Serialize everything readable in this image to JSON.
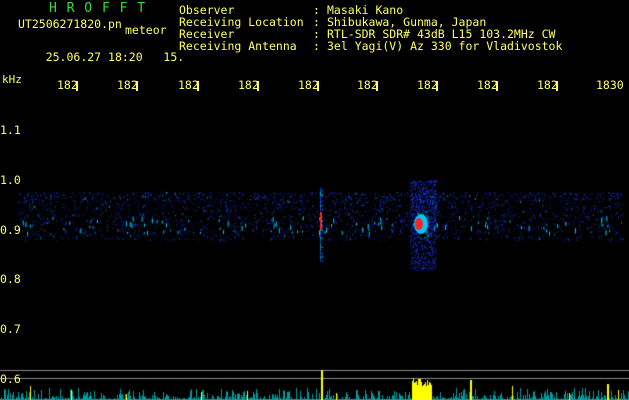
{
  "header": {
    "app_title": "H R O F F T",
    "filename": "UT2506271820.pn",
    "filename_suffix": "meteor",
    "datetime": "25.06.27 18:20",
    "counter": "15.",
    "fields": [
      {
        "label": "Observer",
        "value": "Masaki Kano"
      },
      {
        "label": "Receiving Location",
        "value": "Shibukawa, Gunma, Japan"
      },
      {
        "label": "Receiver",
        "value": "RTL-SDR SDR# 43dB L15 103.2MHz CW"
      },
      {
        "label": "Receiving Antenna",
        "value": "3el Yagi(V) Az 330 for Vladivostok"
      }
    ],
    "colon": ":"
  },
  "axes": {
    "y_unit": "kHz",
    "y_ticks": [
      "1.1",
      "1.0",
      "0.9",
      "0.8",
      "0.7",
      "0.6"
    ],
    "x_ticks": [
      "182",
      "182",
      "182",
      "182",
      "182",
      "182",
      "182",
      "182",
      "182",
      "1830"
    ]
  },
  "colors": {
    "background": "#000000",
    "text": "#ffff66",
    "title": "#33dd33",
    "signal_low": "#1e3cff",
    "signal_mid": "#00c8ff",
    "signal_peak": "#ff2020",
    "level_bar": "#ffff00",
    "baseline": "#00e0e0"
  }
}
